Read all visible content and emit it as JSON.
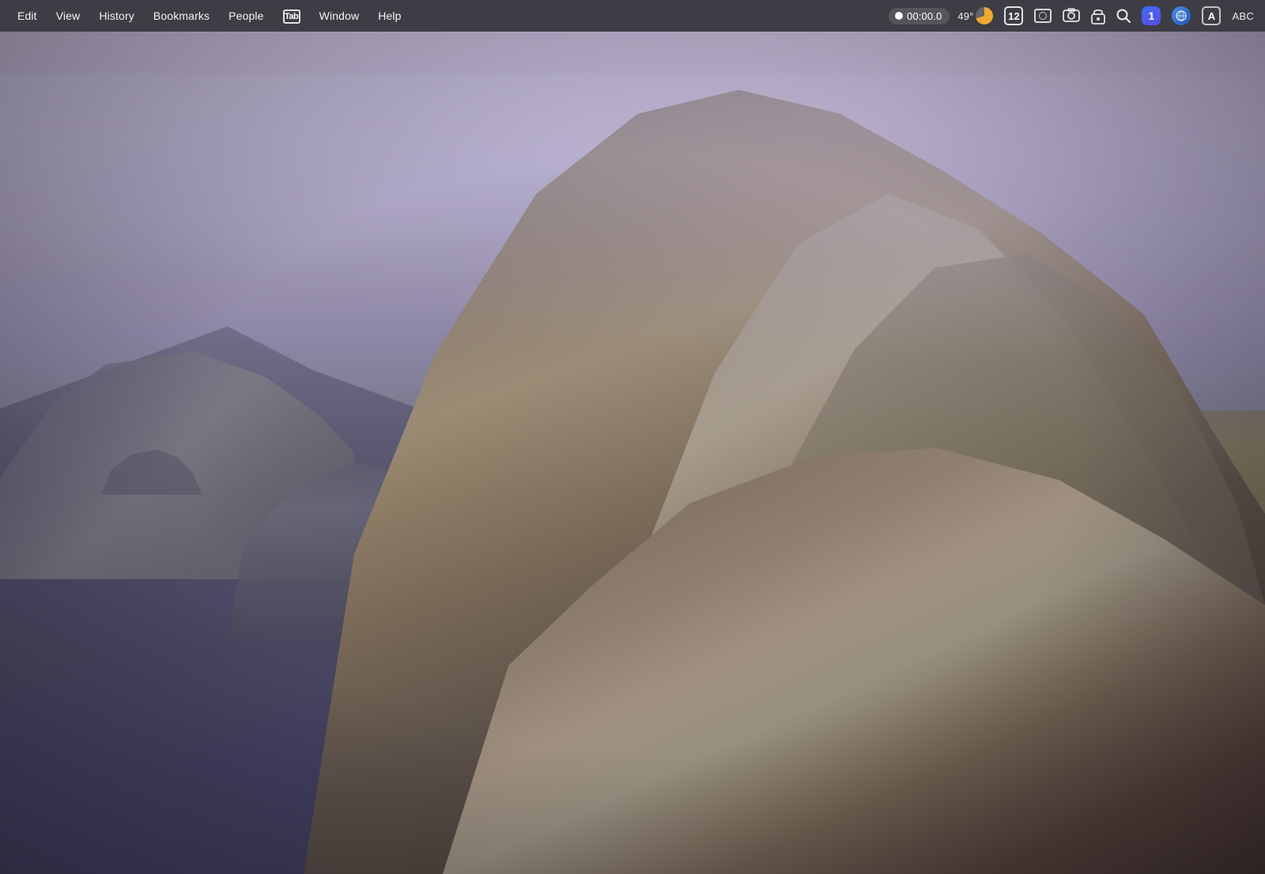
{
  "menubar": {
    "items": [
      {
        "id": "edit",
        "label": "Edit"
      },
      {
        "id": "view",
        "label": "View"
      },
      {
        "id": "history",
        "label": "History"
      },
      {
        "id": "bookmarks",
        "label": "Bookmarks"
      },
      {
        "id": "people",
        "label": "People"
      },
      {
        "id": "tab",
        "label": "Tab"
      },
      {
        "id": "window",
        "label": "Window"
      },
      {
        "id": "help",
        "label": "Help"
      }
    ],
    "status": {
      "record_time": "00:00.0",
      "temperature": "49°",
      "badge_number": "12",
      "abc_label": "ABC"
    }
  },
  "background": {
    "scene": "Coastal mountain landscape at dusk with purple-tinted sky and rocky cliffs"
  }
}
